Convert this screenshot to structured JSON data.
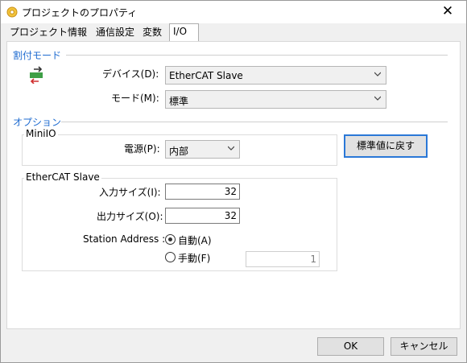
{
  "window": {
    "title": "プロジェクトのプロパティ",
    "close_glyph": "✕"
  },
  "tabs": [
    {
      "label": "プロジェクト情報"
    },
    {
      "label": "通信設定"
    },
    {
      "label": "変数"
    },
    {
      "label": "I/O",
      "active": true
    }
  ],
  "interrupt_section": {
    "title": "割付モード",
    "device_label": "デバイス(D):",
    "device_value": "EtherCAT Slave",
    "mode_label": "モード(M):",
    "mode_value": "標準"
  },
  "options_section": {
    "title": "オプション",
    "miniio": {
      "group_title": "MiniIO",
      "power_label": "電源(P):",
      "power_value": "内部"
    },
    "reset_button_label": "標準値に戻す",
    "ethercat": {
      "group_title": "EtherCAT Slave",
      "input_size_label": "入力サイズ(I):",
      "input_size_value": "32",
      "output_size_label": "出力サイズ(O):",
      "output_size_value": "32",
      "station_address_label": "Station Address :",
      "auto_label": "自動(A)",
      "manual_label": "手動(F)",
      "manual_value": "1",
      "selected": "auto"
    }
  },
  "footer": {
    "ok_label": "OK",
    "cancel_label": "キャンセル"
  },
  "colors": {
    "section_title": "#1e6bd0",
    "default_button_border": "#2a78d7",
    "dialog_bg": "#f0f0f0"
  },
  "icons": {
    "title": "gear-icon",
    "device": "io-transfer-icon",
    "dropdown": "chevron-down-icon"
  }
}
